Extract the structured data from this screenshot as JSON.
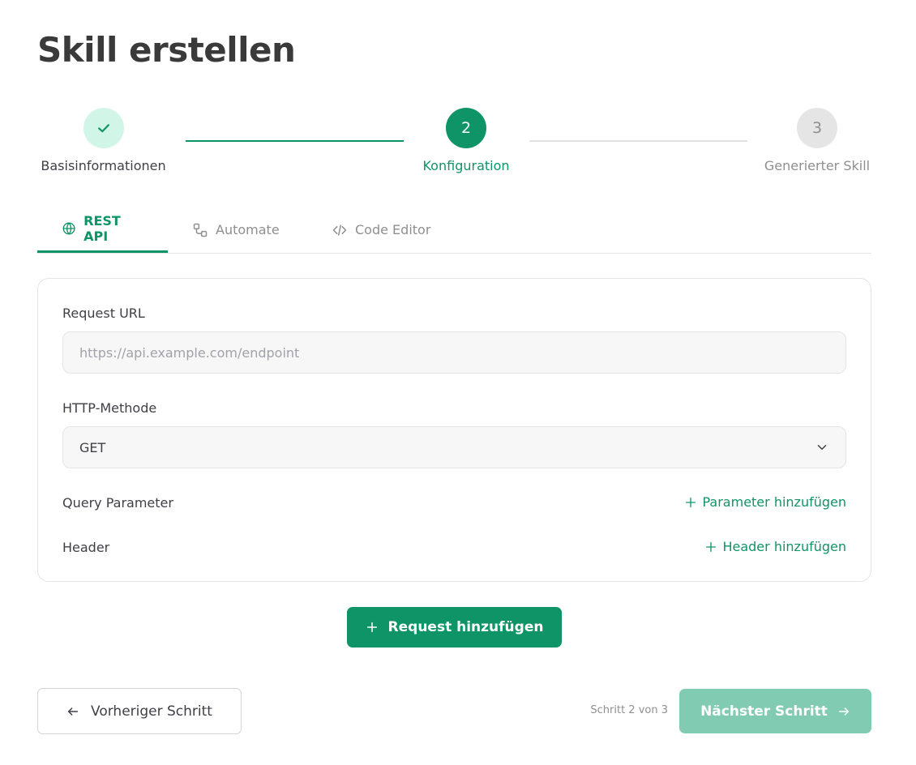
{
  "page": {
    "title": "Skill erstellen"
  },
  "stepper": {
    "steps": [
      {
        "number": "1",
        "label": "Basisinformationen",
        "state": "completed",
        "icon": "check-icon"
      },
      {
        "number": "2",
        "label": "Konfiguration",
        "state": "active"
      },
      {
        "number": "3",
        "label": "Generierter Skill",
        "state": "upcoming"
      }
    ]
  },
  "tabs": [
    {
      "label": "REST API",
      "icon": "globe-icon",
      "active": true
    },
    {
      "label": "Automate",
      "icon": "workflow-icon",
      "active": false
    },
    {
      "label": "Code Editor",
      "icon": "code-icon",
      "active": false
    }
  ],
  "form": {
    "request_url": {
      "label": "Request URL",
      "value": "",
      "placeholder": "https://api.example.com/endpoint"
    },
    "http_method": {
      "label": "HTTP-Methode",
      "selected": "GET",
      "icon": "chevron-down-icon"
    },
    "query_params": {
      "label": "Query Parameter",
      "add_label": "Parameter hinzufügen",
      "icon": "plus-icon"
    },
    "headers": {
      "label": "Header",
      "add_label": "Header hinzufügen",
      "icon": "plus-icon"
    }
  },
  "actions": {
    "add_request": "Request hinzufügen",
    "previous": "Vorheriger Schritt",
    "next": "Nächster Schritt",
    "step_counter": "Schritt 2 von 3"
  },
  "colors": {
    "accent": "#0f9468",
    "accent_light": "#d1f5e6",
    "accent_disabled": "#80cbb2",
    "muted": "#8f8f8f",
    "border": "#e4e4e7"
  }
}
